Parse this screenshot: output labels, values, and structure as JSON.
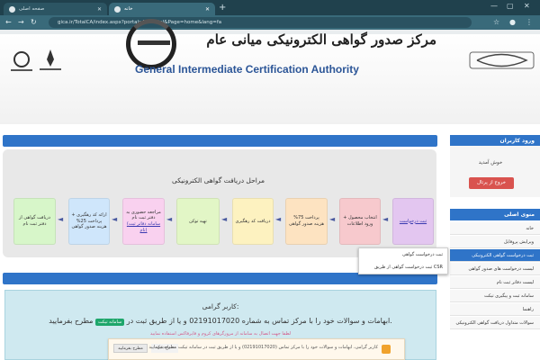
{
  "browser": {
    "tabs": [
      {
        "title": "صفحه اصلی"
      },
      {
        "title": "خانه"
      }
    ],
    "url": "gica.ir/TotalCA/index.aspx?portal=MFPortal&Page=home&lang=fa",
    "new_tab_label": "+"
  },
  "header": {
    "title_fa": "مرکز صدور گواهی الکترونیکی میانی عام",
    "title_en": "General Intermediate Certification Authority"
  },
  "process": {
    "title": "مراحل دریافت گواهی الکترونیکی",
    "steps": [
      {
        "label": "ثبت درخواست",
        "color": "#e3c6f0"
      },
      {
        "label": "انتخاب محصول + ورود اطلاعات",
        "color": "#f7c9cd"
      },
      {
        "label": "پرداخت 75% هزینه صدور گواهی",
        "color": "#fde3c1"
      },
      {
        "label": "دریافت کد رهگیری",
        "color": "#fdf2c0"
      },
      {
        "label": "تهیه توکن",
        "color": "#e2f6c6"
      },
      {
        "label": "مراجعه حضوری به دفتر ثبت نام",
        "link": "(سامانه دفاتر ثبت نام)",
        "color": "#f9d1ef"
      },
      {
        "label": "ارائه کد رهگیری + پرداخت 25% هزینه صدور گواهی",
        "color": "#cfe6fb"
      },
      {
        "label": "دریافت گواهی از دفتر ثبت نام",
        "color": "#d7f6c9"
      }
    ],
    "arrow": "◄"
  },
  "notice": {
    "greeting": "کاربر گرامی:",
    "main_text": "ابهامات و سوالات خود را با مرکز تماس به شماره 02191017020 و یا از طریق ثبت در",
    "tag_label": "سامانه تیکت",
    "main_suffix": "مطرح بفرمایید.",
    "sub_text": "لطفا جهت اتصال به سامانه از مرورگرهای کروم و فایرفاکس استفاده نمایید",
    "toast_text": "کاربر گرامی، ابهامات و سوالات خود را با مرکز تماس (02191017020) و یا از طریق ثبت در سامانه تیکت مطرح بفرمایید",
    "toast_button": "سامانه تیکت",
    "toast_dismiss": "مطرح بفرمایید"
  },
  "sidebar": {
    "login_title": "ورود کاربران",
    "welcome": "خوش آمدید",
    "logout": "خروج از پرتال",
    "menu_title": "منوی اصلی",
    "items": [
      {
        "label": "خانه"
      },
      {
        "label": "ویرایش پروفایل"
      },
      {
        "label": "ثبت درخواست گواهی الکترونیکی"
      },
      {
        "label": "لیست درخواست های صدور گواهی"
      },
      {
        "label": "لیست دفاتر ثبت نام"
      },
      {
        "label": "سامانه ثبت و پیگیری تیکت"
      },
      {
        "label": "راهنما"
      },
      {
        "label": "سوالات متداول دریافت گواهی الکترونیکی"
      }
    ],
    "dropdown": [
      {
        "label": "ثبت درخواست گواهی"
      },
      {
        "label": "ثبت درخواست گواهی از طریق CSR"
      }
    ]
  },
  "colors": {
    "accent_blue": "#2f74c8",
    "logout_red": "#d9534f",
    "chrome_frame": "#20414d",
    "notice_bg": "#cfe9f0"
  }
}
